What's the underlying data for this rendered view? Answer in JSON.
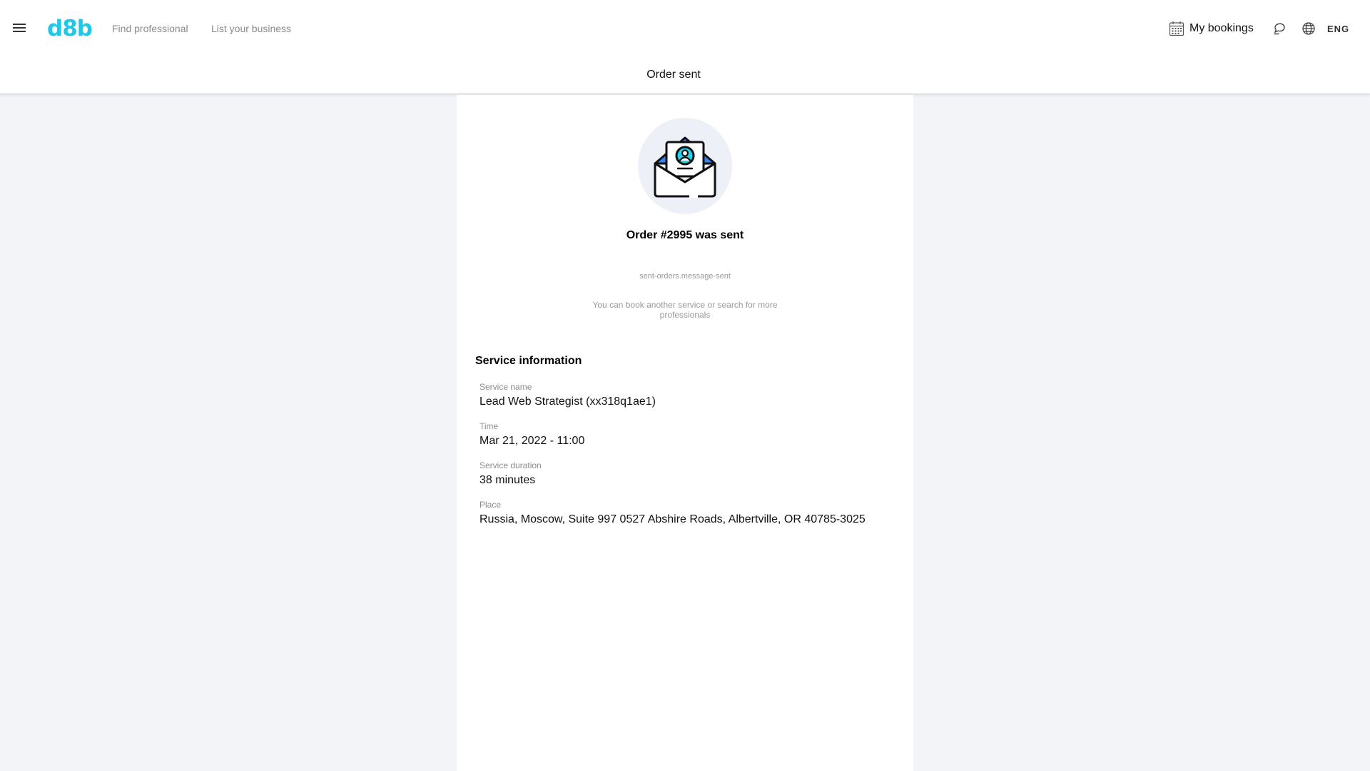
{
  "header": {
    "logo": "d8b",
    "nav": [
      {
        "label": "Find professional"
      },
      {
        "label": "List your business"
      }
    ],
    "bookings_label": "My bookings",
    "language": "ENG"
  },
  "page": {
    "title": "Order sent"
  },
  "order": {
    "title": "Order #2995 was sent",
    "message_key": "sent-orders.message-sent",
    "hint": "You can book another service or search for more professionals"
  },
  "service": {
    "section_title": "Service information",
    "fields": [
      {
        "label": "Service name",
        "value": "Lead Web Strategist (xx318q1ae1)"
      },
      {
        "label": "Time",
        "value": "Mar 21, 2022 - 11:00"
      },
      {
        "label": "Service duration",
        "value": "38 minutes"
      },
      {
        "label": "Place",
        "value": "Russia, Moscow, Suite 997 0527 Abshire Roads, Albertville, OR 40785-3025"
      }
    ]
  },
  "colors": {
    "brand": "#1ec8e8",
    "page_background": "#f3f4f8",
    "illustration_background": "#eef0f7",
    "envelope_flap": "#3b82f6",
    "avatar_circle": "#22d3ee"
  },
  "icons": {
    "menu": "hamburger-menu-icon",
    "bookings": "calendar-icon",
    "chat": "chat-bubble-icon",
    "language": "globe-icon",
    "illustration": "open-envelope-with-profile-card"
  }
}
